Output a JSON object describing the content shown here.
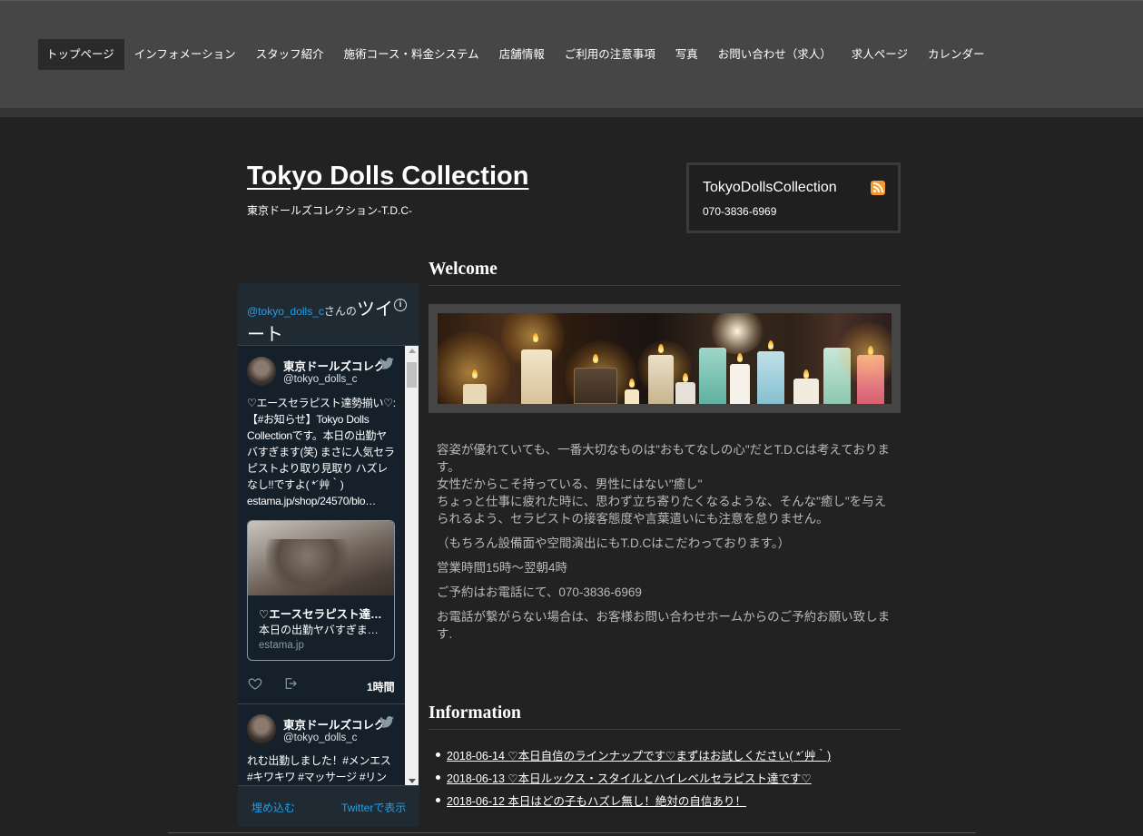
{
  "nav": {
    "items": [
      {
        "label": "トップページ",
        "active": true
      },
      {
        "label": "インフォメーション"
      },
      {
        "label": "スタッフ紹介"
      },
      {
        "label": "施術コース・料金システム"
      },
      {
        "label": "店舗情報"
      },
      {
        "label": "ご利用の注意事項"
      },
      {
        "label": "写真"
      },
      {
        "label": "お問い合わせ（求人）"
      },
      {
        "label": "求人ページ"
      },
      {
        "label": "カレンダー"
      }
    ]
  },
  "header": {
    "title": "Tokyo Dolls Collection",
    "tagline": "東京ドールズコレクション-T.D.C-"
  },
  "contact": {
    "name": "TokyoDollsCollection",
    "phone": "070-3836-6969",
    "rss_icon": "rss-icon"
  },
  "twitter": {
    "handle": "@tokyo_dolls_c",
    "handle_suffix": "さんの",
    "heading_big_1": "ツイ",
    "heading_big_2": "ート",
    "info_icon": "i",
    "tweets": [
      {
        "name": "東京ドールズコレク",
        "user": "@tokyo_dolls_c",
        "text": "♡エースセラピスト達勢揃い♡: 【#お知らせ】Tokyo Dolls Collectionです。本日の出勤ヤバすぎます(笑) まさに人気セラピストより取り見取り ハズレなし!!ですよ( *´艸｀)",
        "link": "estama.jp/shop/24570/blo…",
        "card_title": "♡エースセラピスト達…",
        "card_desc": "本日の出勤ヤバすぎま…",
        "card_domain": "estama.jp",
        "time": "1時間"
      },
      {
        "name": "東京ドールズコレク",
        "user": "@tokyo_dolls_c",
        "text": "れむ出勤しました！#メンエス #キワキワ #マッサージ #リン"
      }
    ],
    "footer_embed": "埋め込む",
    "footer_view": "Twitterで表示"
  },
  "welcome": {
    "heading": "Welcome",
    "paragraphs": [
      "容姿が優れていても、一番大切なものは\"おもてなしの心\"だとT.D.Cは考えております。",
      "女性だからこそ持っている、男性にはない\"癒し\"",
      "ちょっと仕事に疲れた時に、思わず立ち寄りたくなるような、そんな\"癒し\"を与えられるよう、セラピストの接客態度や言葉遣いにも注意を怠りません。",
      "（もちろん設備面や空間演出にもT.D.Cはこだわっております。）",
      "営業時間15時～翌朝4時",
      "ご予約はお電話にて、070-3836-6969",
      "お電話が繋がらない場合は、お客様お問い合わせホームからのご予約お願い致します."
    ]
  },
  "information": {
    "heading": "Information",
    "items": [
      {
        "text": "2018-06-14 ♡本日自信のラインナップです♡まずはお試しください( *´艸｀)"
      },
      {
        "text": "2018-06-13 ♡本日ルックス・スタイルとハイレベルセラピスト達です♡"
      },
      {
        "text": "2018-06-12 本日はどの子もハズレ無し！絶対の自信あり！"
      }
    ]
  },
  "colors": {
    "background": "#222222",
    "topbar": "#464646",
    "twitter_link": "#1da1f2",
    "rss": "#f59a2c"
  }
}
